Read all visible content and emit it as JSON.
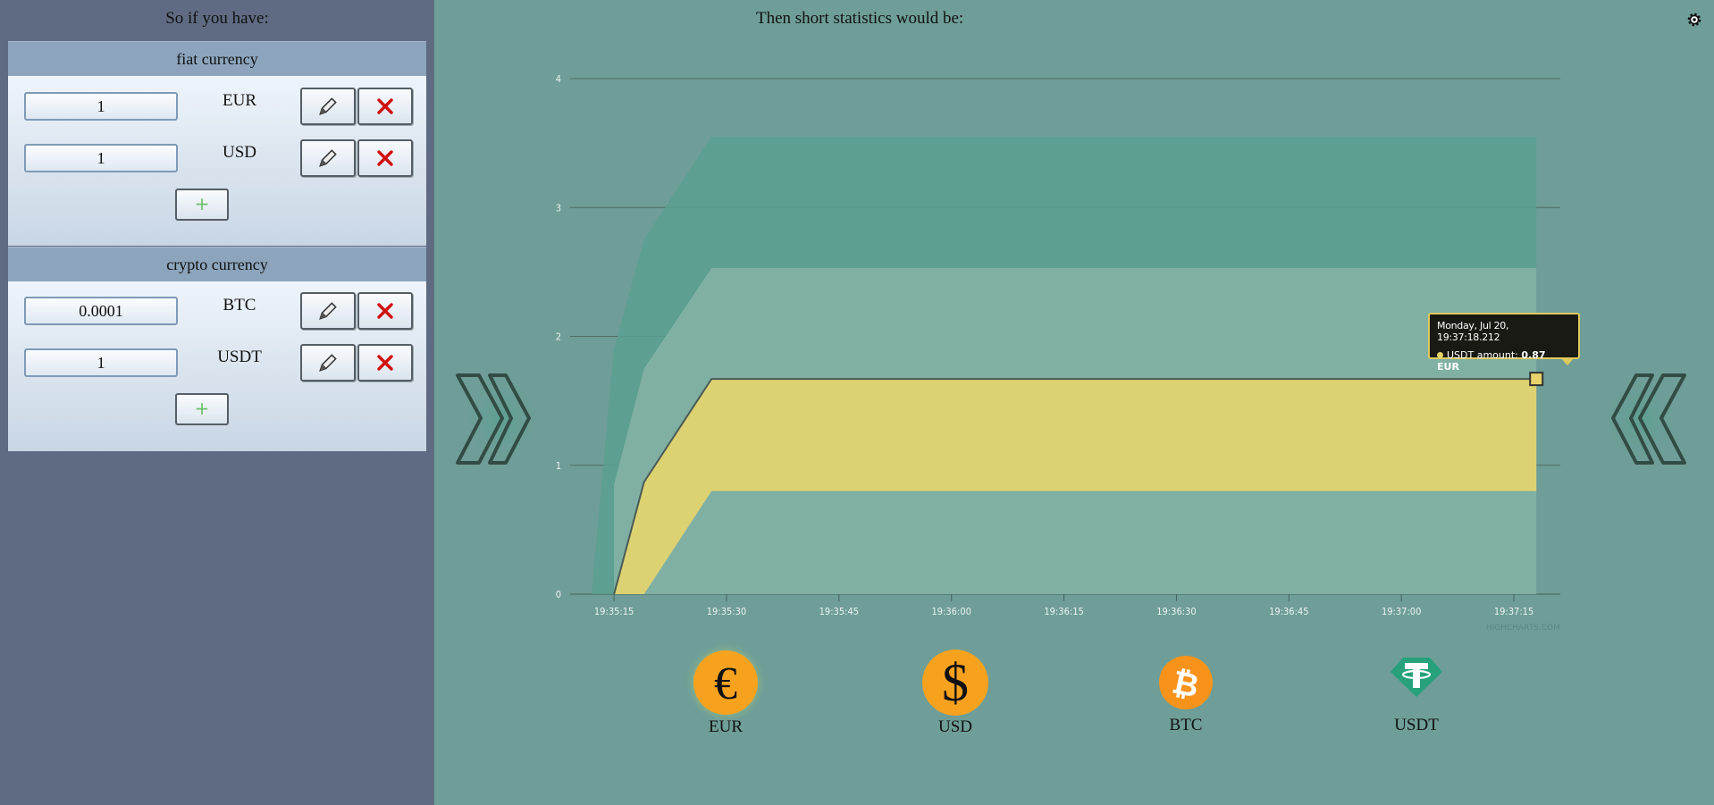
{
  "left": {
    "heading": "So if you have:",
    "fiat": {
      "title": "fiat currency",
      "rows": [
        {
          "amount": "1",
          "code": "EUR"
        },
        {
          "amount": "1",
          "code": "USD"
        }
      ],
      "add_label": "+"
    },
    "crypto": {
      "title": "crypto currency",
      "rows": [
        {
          "amount": "0.0001",
          "code": "BTC"
        },
        {
          "amount": "1",
          "code": "USDT"
        }
      ],
      "add_label": "+"
    }
  },
  "right": {
    "heading": "Then short statistics would be:",
    "credit": "HIGHCHARTS.COM",
    "tooltip": {
      "date": "Monday, Jul 20, 19:37:18.212",
      "series": "USDT amount",
      "value": "0.87 EUR"
    },
    "coins": [
      {
        "label": "EUR",
        "symbol": "€",
        "icon": "euro-icon",
        "selected": true
      },
      {
        "label": "USD",
        "symbol": "$",
        "icon": "dollar-icon",
        "selected": false
      },
      {
        "label": "BTC",
        "symbol": "₿",
        "icon": "bitcoin-icon",
        "selected": false
      },
      {
        "label": "USDT",
        "symbol": "T",
        "icon": "tether-icon",
        "selected": false
      }
    ]
  },
  "chart_data": {
    "type": "area",
    "x_ticks": [
      "19:35:15",
      "19:35:30",
      "19:35:45",
      "19:36:00",
      "19:36:15",
      "19:36:30",
      "19:36:45",
      "19:37:00",
      "19:37:15"
    ],
    "y_ticks": [
      "0",
      "1",
      "2",
      "3",
      "4"
    ],
    "ylim": [
      0,
      4
    ],
    "xlim_seconds_after_19_35_00": [
      7,
      140
    ],
    "grid": true,
    "series": [
      {
        "name": "",
        "color": "#5a9f8e",
        "x": [
          "19:35:12",
          "19:35:15",
          "19:35:19",
          "19:35:28",
          "19:37:18"
        ],
        "low": [
          0,
          0,
          0,
          0,
          0
        ],
        "high": [
          0,
          1.9,
          2.75,
          3.55,
          3.55
        ]
      },
      {
        "name": "",
        "color": "#86b3a8",
        "x": [
          "19:35:15",
          "19:35:19",
          "19:35:28",
          "19:37:18"
        ],
        "low": [
          0,
          0,
          0,
          0
        ],
        "high": [
          0.85,
          1.75,
          2.53,
          2.53
        ]
      },
      {
        "name": "USDT amount",
        "color": "#e2d470",
        "x": [
          "19:35:15",
          "19:35:19",
          "19:35:28",
          "19:37:18"
        ],
        "low": [
          0,
          0,
          0.8,
          0.8
        ],
        "high": [
          0,
          0.87,
          1.67,
          1.67
        ]
      }
    ],
    "hover_point": {
      "x": "19:37:18",
      "y": 1.67
    }
  }
}
